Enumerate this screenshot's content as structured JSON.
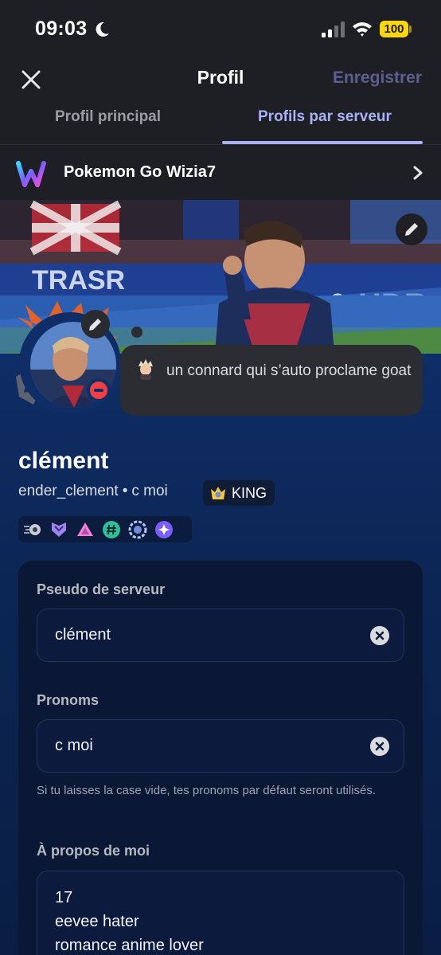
{
  "status_bar": {
    "time": "09:03",
    "battery": "100"
  },
  "header": {
    "title": "Profil",
    "save_label": "Enregistrer",
    "tabs": [
      {
        "label": "Profil principal",
        "active": false
      },
      {
        "label": "Profils par serveur",
        "active": true
      }
    ]
  },
  "server": {
    "name": "Pokemon Go Wizia7"
  },
  "profile": {
    "custom_status": "un connard qui s’auto proclame goat",
    "display_name": "clément",
    "username": "ender_clement",
    "pronouns_inline": "c moi",
    "guild_tag": "KING",
    "status": "do-not-disturb",
    "badges": [
      "speed-badge-icon",
      "shield-badge-icon",
      "triangle-badge-icon",
      "hashtag-badge-icon",
      "laurel-badge-icon",
      "quest-badge-icon"
    ]
  },
  "form": {
    "nickname_label": "Pseudo de serveur",
    "nickname_value": "clément",
    "pronouns_label": "Pronoms",
    "pronouns_value": "c moi",
    "pronouns_helper": "Si tu laisses la case vide, tes pronoms par défaut seront utilisés.",
    "about_label": "À propos de moi",
    "about_lines": [
      "17",
      "eevee hater",
      "romance anime lover"
    ]
  },
  "colors": {
    "accent": "#a9b1f6",
    "profile_bg": "#0f2d66",
    "dnd_status": "#f23f43",
    "battery": "#ffd60a"
  }
}
